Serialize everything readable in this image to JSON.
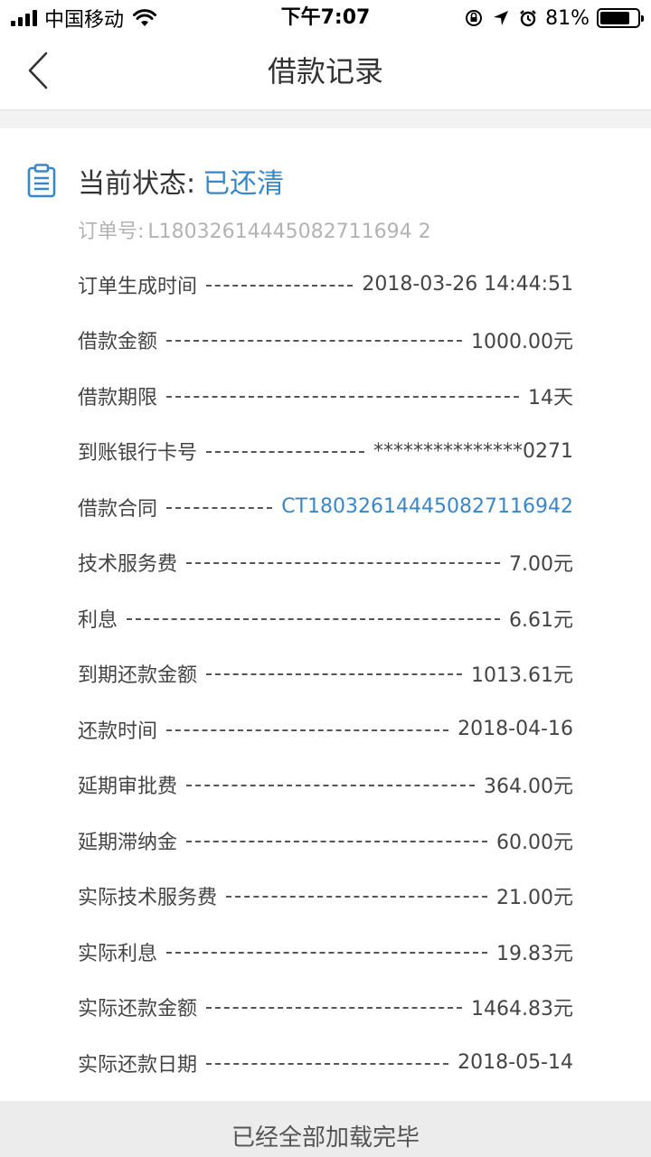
{
  "status_bar": {
    "carrier": "中国移动",
    "time": "下午7:07",
    "battery": "81%",
    "battery_level": 0.81
  },
  "nav": {
    "title": "借款记录"
  },
  "status": {
    "label": "当前状态:",
    "value": "已还清"
  },
  "order": {
    "label": "订单号:",
    "value": "L18032614445082711694 2"
  },
  "rows": [
    {
      "label": "订单生成时间",
      "value": "2018-03-26 14:44:51"
    },
    {
      "label": "借款金额",
      "value": "1000.00元"
    },
    {
      "label": "借款期限",
      "value": "14天"
    },
    {
      "label": "到账银行卡号",
      "value": "***************0271"
    },
    {
      "label": "借款合同",
      "value": "CT180326144450827116942"
    },
    {
      "label": "技术服务费",
      "value": "7.00元"
    },
    {
      "label": "利息",
      "value": "6.61元"
    },
    {
      "label": "到期还款金额",
      "value": "1013.61元"
    },
    {
      "label": "还款时间",
      "value": "2018-04-16"
    },
    {
      "label": "延期审批费",
      "value": "364.00元"
    },
    {
      "label": "延期滞纳金",
      "value": "60.00元"
    },
    {
      "label": "实际技术服务费",
      "value": "21.00元"
    },
    {
      "label": "实际利息",
      "value": "19.83元"
    },
    {
      "label": "实际还款金额",
      "value": "1464.83元"
    },
    {
      "label": "实际还款日期",
      "value": "2018-05-14"
    }
  ],
  "footer": {
    "text": "已经全部加载完毕"
  },
  "colors": {
    "accent": "#3a87c8",
    "muted": "#b3b3b3"
  }
}
